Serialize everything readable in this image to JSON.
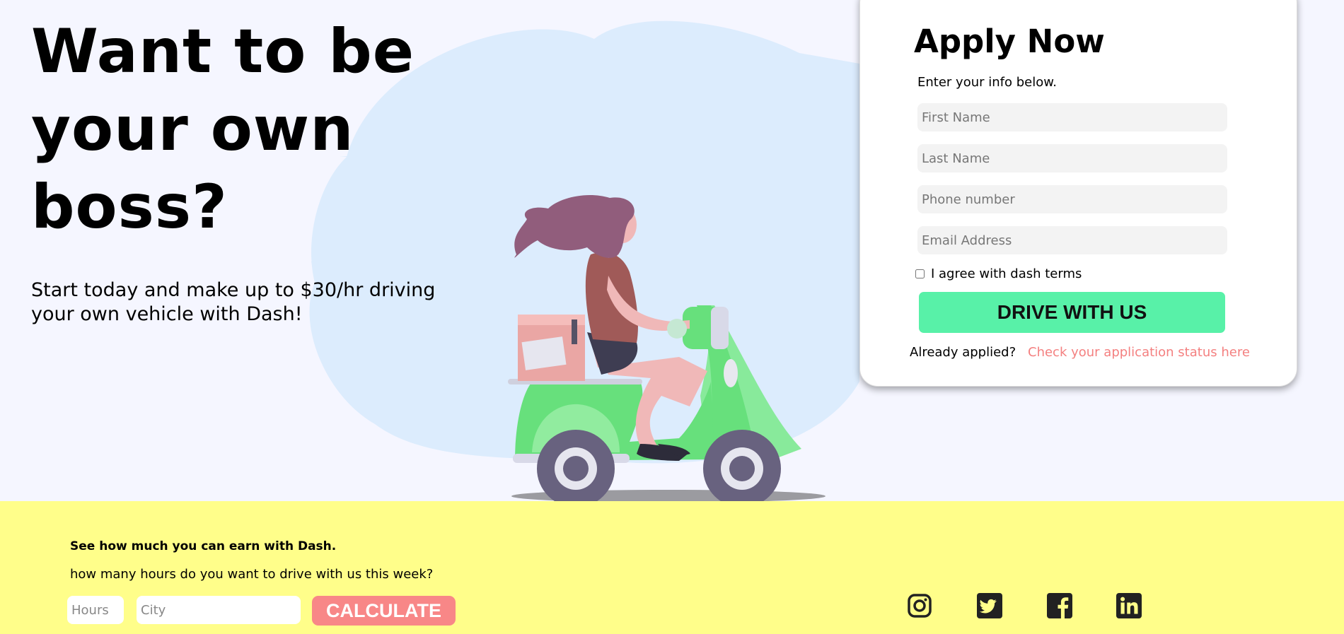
{
  "hero": {
    "headline": "Want to be your own boss?",
    "subheadline": "Start today and make up to $30/hr driving your own vehicle with Dash!"
  },
  "apply_card": {
    "title": "Apply Now",
    "subtitle": "Enter your info below.",
    "fields": {
      "first_name_placeholder": "First Name",
      "last_name_placeholder": "Last Name",
      "phone_placeholder": "Phone number",
      "email_placeholder": "Email Address"
    },
    "terms_label": "I agree with dash terms",
    "terms_checked": false,
    "submit_label": "DRIVE WITH US",
    "already_applied": "Already applied?",
    "status_link": "Check your application status here"
  },
  "earnings": {
    "title": "See how much you can earn with Dash.",
    "question": "how many hours do you want to drive with us this week?",
    "hours_placeholder": "Hours",
    "city_placeholder": "City",
    "calculate_label": "CALCULATE"
  },
  "social": [
    "instagram-icon",
    "twitter-icon",
    "facebook-icon",
    "linkedin-icon"
  ],
  "colors": {
    "accent_green": "#58f1a8",
    "accent_salmon": "#f88787",
    "link": "#f48080",
    "footer_bg": "#fffe8a",
    "hero_bg": "#f5f6ff",
    "blob": "#dcecfd"
  }
}
